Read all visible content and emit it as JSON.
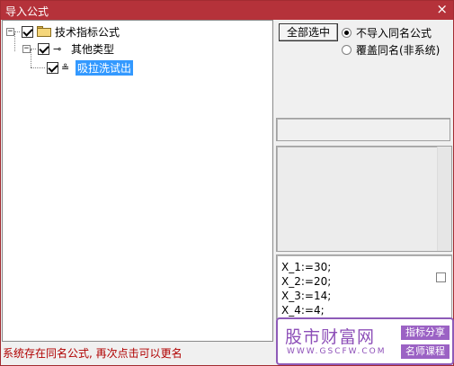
{
  "window": {
    "title": "导入公式",
    "close_glyph": "×"
  },
  "tree": {
    "items": [
      {
        "label": "技术指标公式",
        "expander": "−",
        "checked": true,
        "icon": "folder-icon"
      },
      {
        "label": "其他类型",
        "expander": "−",
        "checked": true,
        "icon": "key-icon"
      },
      {
        "label": "吸拉洗试出",
        "checked": true,
        "icon": "formula-icon",
        "selected": true
      }
    ]
  },
  "buttons": {
    "select_all": "全部选中"
  },
  "options": {
    "no_import_same_name": {
      "label": "不导入同名公式",
      "checked": true
    },
    "overwrite_same_name": {
      "label": "覆盖同名(非系统)",
      "checked": false
    }
  },
  "code": {
    "lines": [
      "X_1:=30;",
      "X_2:=20;",
      "X_3:=14;",
      "X_4:=4;"
    ]
  },
  "status": {
    "message": "系统存在同名公式, 再次点击可以更名"
  },
  "watermark": {
    "site_name": "股市财富网",
    "site_url": "WWW.GSCFW.COM",
    "tag1": "指标分享",
    "tag2": "名师课程"
  },
  "colors": {
    "titlebar": "#b5323a",
    "selection": "#3399ff",
    "status_text": "#b00000",
    "watermark": "#8d4fb8"
  }
}
